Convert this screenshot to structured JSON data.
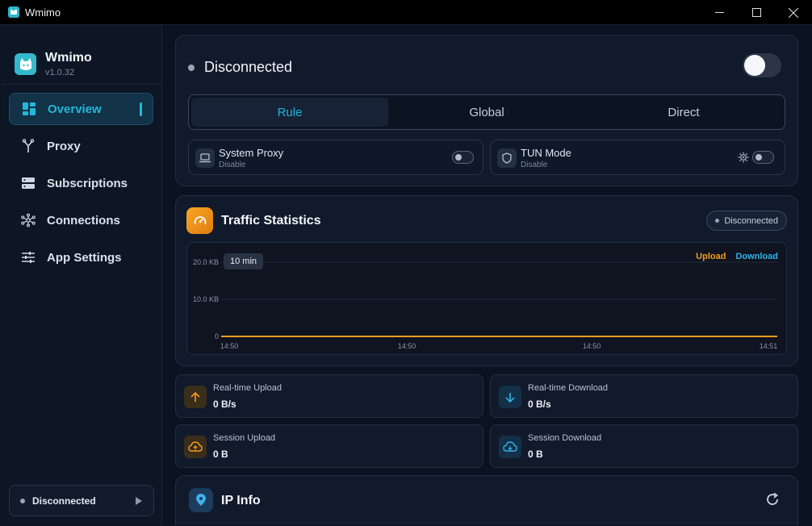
{
  "window": {
    "title": "Wmimo"
  },
  "sidebar": {
    "app_name": "Wmimo",
    "version": "v1.0.32",
    "items": [
      {
        "label": "Overview",
        "icon": "dashboard-icon",
        "active": true
      },
      {
        "label": "Proxy",
        "icon": "fork-icon",
        "active": false
      },
      {
        "label": "Subscriptions",
        "icon": "server-icon",
        "active": false
      },
      {
        "label": "Connections",
        "icon": "network-icon",
        "active": false
      },
      {
        "label": "App Settings",
        "icon": "sliders-icon",
        "active": false
      }
    ],
    "status_label": "Disconnected"
  },
  "connection": {
    "status": "Disconnected",
    "enabled": false,
    "modes": [
      "Rule",
      "Global",
      "Direct"
    ],
    "active_mode": "Rule",
    "system_proxy": {
      "label": "System Proxy",
      "state": "Disable",
      "enabled": false
    },
    "tun_mode": {
      "label": "TUN Mode",
      "state": "Disable",
      "enabled": false
    }
  },
  "traffic": {
    "title": "Traffic Statistics",
    "status_pill": "Disconnected",
    "range": "10 min",
    "legend_upload": "Upload",
    "legend_download": "Download"
  },
  "chart_data": {
    "type": "line",
    "x": [
      "14:50",
      "14:50",
      "14:50",
      "14:51"
    ],
    "y_ticks": [
      "20.0 KB",
      "10.0 KB",
      "0"
    ],
    "ylim": [
      0,
      20
    ],
    "series": [
      {
        "name": "Upload",
        "values": [
          0,
          0,
          0,
          0
        ],
        "color": "#f39c1f"
      },
      {
        "name": "Download",
        "values": [
          0,
          0,
          0,
          0
        ],
        "color": "#2fb2e8"
      }
    ]
  },
  "stats": {
    "realtime_upload": {
      "label": "Real-time Upload",
      "value": "0 B/s"
    },
    "realtime_download": {
      "label": "Real-time Download",
      "value": "0 B/s"
    },
    "session_upload": {
      "label": "Session Upload",
      "value": "0 B"
    },
    "session_download": {
      "label": "Session Download",
      "value": "0 B"
    }
  },
  "ip_info": {
    "title": "IP Info"
  },
  "colors": {
    "accent": "#22b8d8",
    "upload": "#f39c1f",
    "download": "#2fb2e8"
  }
}
